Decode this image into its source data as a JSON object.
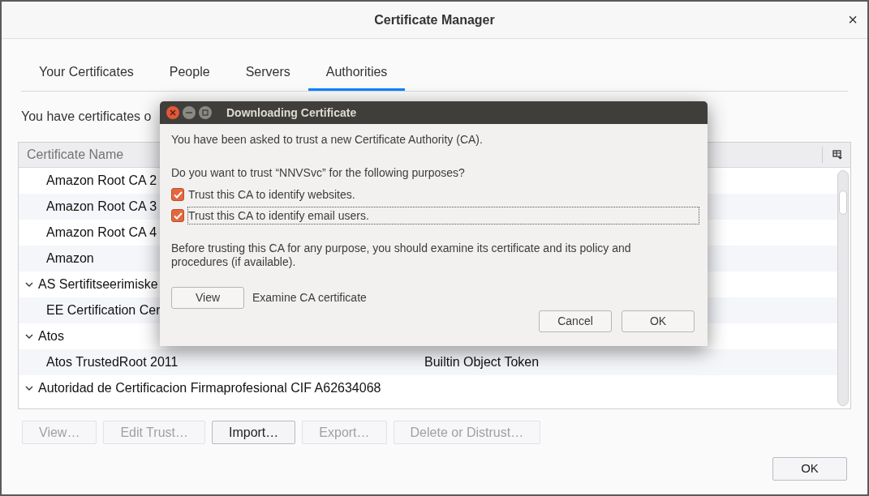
{
  "window": {
    "title": "Certificate Manager",
    "close": "×"
  },
  "tabs": [
    {
      "label": "Your Certificates",
      "selected": false
    },
    {
      "label": "People",
      "selected": false
    },
    {
      "label": "Servers",
      "selected": false
    },
    {
      "label": "Authorities",
      "selected": true
    }
  ],
  "intro": "You have certificates o",
  "table": {
    "columns": [
      {
        "label": "Certificate Name"
      }
    ],
    "rows": [
      {
        "kind": "cert",
        "name": "Amazon Root CA 2"
      },
      {
        "kind": "cert",
        "name": "Amazon Root CA 3"
      },
      {
        "kind": "cert",
        "name": "Amazon Root CA 4"
      },
      {
        "kind": "cert",
        "name": "Amazon"
      },
      {
        "kind": "group",
        "name": "AS Sertifitseerimiske",
        "expanded": true,
        "children": [
          {
            "kind": "cert",
            "name": "EE Certification Cer"
          }
        ]
      },
      {
        "kind": "group",
        "name": "Atos",
        "expanded": true,
        "children": [
          {
            "kind": "cert",
            "name": "Atos TrustedRoot 2011",
            "token": "Builtin Object Token"
          }
        ]
      },
      {
        "kind": "group",
        "name": "Autoridad de Certificacion Firmaprofesional CIF A62634068",
        "expanded": true
      }
    ]
  },
  "buttons": [
    {
      "label": "View…",
      "disabled": true
    },
    {
      "label": "Edit Trust…",
      "disabled": true
    },
    {
      "label": "Import…",
      "disabled": false
    },
    {
      "label": "Export…",
      "disabled": true
    },
    {
      "label": "Delete or Distrust…",
      "disabled": true
    }
  ],
  "ok_button": "OK",
  "dialog": {
    "title": "Downloading Certificate",
    "message": "You have been asked to trust a new Certificate Authority (CA).",
    "question": "Do you want to trust “NNVSvc” for the following purposes?",
    "purposes": [
      {
        "label": "Trust this CA to identify websites.",
        "checked": true,
        "focused": false
      },
      {
        "label": "Trust this CA to identify email users.",
        "checked": true,
        "focused": true
      }
    ],
    "advice": "Before trusting this CA for any purpose, you should examine its certificate and its policy and procedures (if available).",
    "view_button": "View",
    "view_hint": "Examine CA certificate",
    "buttons": [
      "Cancel",
      "OK"
    ]
  }
}
